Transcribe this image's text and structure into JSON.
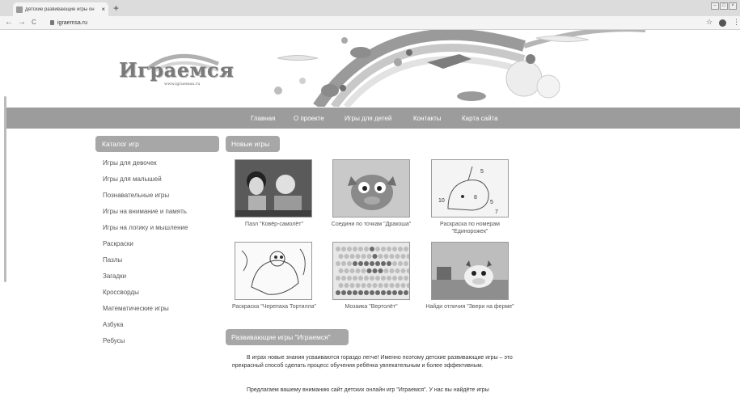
{
  "browser": {
    "tab_title": "Детские развивающие игры он",
    "tab_close": "×",
    "new_tab": "+",
    "url": "igraemsa.ru",
    "nav_back": "←",
    "nav_forward": "→",
    "nav_reload": "C",
    "star": "☆",
    "menu": "⋮"
  },
  "site": {
    "logo_text": "Играемся",
    "logo_url": "www.igraemsa.ru"
  },
  "navbar": {
    "items": [
      {
        "label": "Главная"
      },
      {
        "label": "О проекте"
      },
      {
        "label": "Игры для детей"
      },
      {
        "label": "Контакты"
      },
      {
        "label": "Карта сайта"
      }
    ]
  },
  "sidebar": {
    "title": "Каталог игр",
    "items": [
      {
        "label": "Игры для девочек"
      },
      {
        "label": "Игры для малышей"
      },
      {
        "label": "Познавательные игры"
      },
      {
        "label": "Игры на внимание и память"
      },
      {
        "label": "Игры на логику и мышление"
      },
      {
        "label": "Раскраски"
      },
      {
        "label": "Пазлы"
      },
      {
        "label": "Загадки"
      },
      {
        "label": "Кроссворды"
      },
      {
        "label": "Математические игры"
      },
      {
        "label": "Азбука"
      },
      {
        "label": "Ребусы"
      }
    ]
  },
  "new_games": {
    "title": "Новые игры",
    "games": [
      {
        "caption": "Пазл \"Ковёр-самолёт\"",
        "icon": "carpet-puzzle-thumbnail"
      },
      {
        "caption": "Соедини по точкам \"Дракоша\"",
        "icon": "dragon-dots-thumbnail"
      },
      {
        "caption": "Раскраска по номерам \"Единорожек\"",
        "icon": "unicorn-coloring-thumbnail"
      },
      {
        "caption": "Раскраска \"Черепаха Тортилла\"",
        "icon": "turtle-coloring-thumbnail"
      },
      {
        "caption": "Мозаика \"Вертолёт\"",
        "icon": "helicopter-mosaic-thumbnail"
      },
      {
        "caption": "Найди отличия \"Звери на ферме\"",
        "icon": "farm-differences-thumbnail"
      }
    ]
  },
  "about": {
    "title": "Развивающие игры \"Играемся\"",
    "paragraph1": "В играх новые знания усваиваются гораздо легче! Именно поэтому детские развивающие игры – это прекрасный способ сделать процесс обучения ребёнка увлекательным и более эффективным.",
    "paragraph2": "Предлагаем вашему вниманию сайт детских онлайн игр \"Играемся\". У нас вы найдёте игры"
  }
}
